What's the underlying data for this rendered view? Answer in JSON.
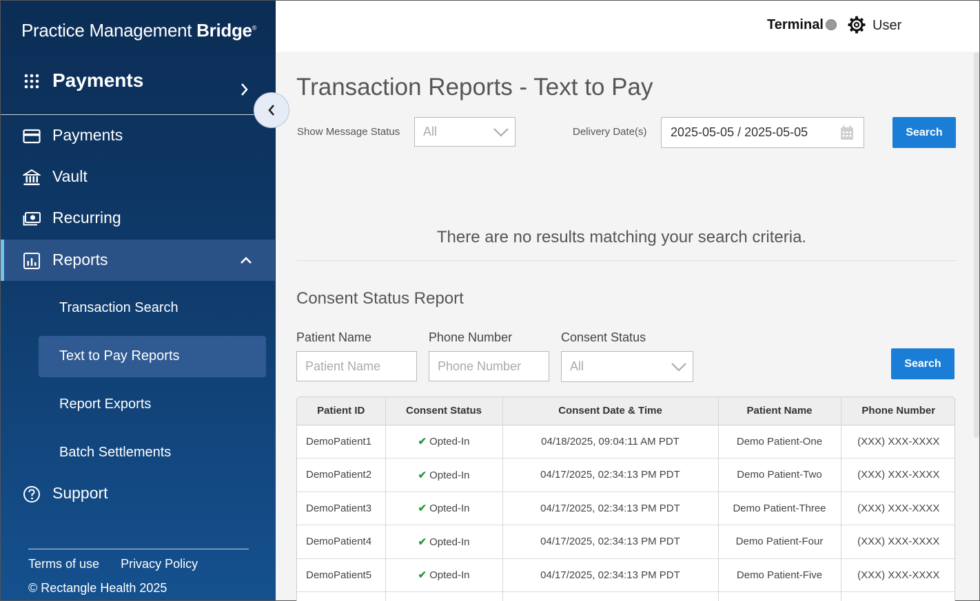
{
  "brand": {
    "logo_text_light": "Practice Management",
    "logo_text_bold": "Bridge",
    "logo_mark": "®"
  },
  "app_switcher": {
    "title": "Payments"
  },
  "nav": {
    "items": [
      {
        "label": "Payments",
        "icon": "credit-card-icon"
      },
      {
        "label": "Vault",
        "icon": "bank-icon"
      },
      {
        "label": "Recurring",
        "icon": "money-icon"
      },
      {
        "label": "Reports",
        "icon": "bar-chart-icon"
      },
      {
        "label": "Support",
        "icon": "question-circle-icon"
      }
    ],
    "report_subitems": [
      {
        "label": "Transaction Search"
      },
      {
        "label": "Text to Pay Reports"
      },
      {
        "label": "Report Exports"
      },
      {
        "label": "Batch Settlements"
      }
    ]
  },
  "footer": {
    "terms": "Terms of use",
    "privacy": "Privacy Policy",
    "copyright": "© Rectangle Health 2025"
  },
  "topbar": {
    "terminal_label": "Terminal",
    "terminal_status_color": "#9a9a9a",
    "user_label": "User"
  },
  "page": {
    "title": "Transaction Reports - Text to Pay",
    "filters": {
      "message_status_label": "Show Message Status",
      "message_status_value": "All",
      "delivery_dates_label": "Delivery Date(s)",
      "delivery_dates_value": "2025-05-05 / 2025-05-05",
      "search_label": "Search"
    },
    "no_results": "There are no results matching your search criteria."
  },
  "consent": {
    "title": "Consent Status Report",
    "patient_name_label": "Patient Name",
    "patient_name_placeholder": "Patient Name",
    "phone_label": "Phone Number",
    "phone_placeholder": "Phone Number",
    "status_label": "Consent Status",
    "status_value": "All",
    "search_label": "Search",
    "columns": [
      "Patient ID",
      "Consent Status",
      "Consent Date & Time",
      "Patient Name",
      "Phone Number"
    ],
    "rows": [
      {
        "id": "DemoPatient1",
        "status": "Opted-In",
        "datetime": "04/18/2025, 09:04:11 AM PDT",
        "name": "Demo Patient-One",
        "phone": "(XXX) XXX-XXXX"
      },
      {
        "id": "DemoPatient2",
        "status": "Opted-In",
        "datetime": "04/17/2025, 02:34:13 PM PDT",
        "name": "Demo Patient-Two",
        "phone": "(XXX) XXX-XXXX"
      },
      {
        "id": "DemoPatient3",
        "status": "Opted-In",
        "datetime": "04/17/2025, 02:34:13 PM PDT",
        "name": "Demo Patient-Three",
        "phone": "(XXX) XXX-XXXX"
      },
      {
        "id": "DemoPatient4",
        "status": "Opted-In",
        "datetime": "04/17/2025, 02:34:13 PM PDT",
        "name": "Demo Patient-Four",
        "phone": "(XXX) XXX-XXXX"
      },
      {
        "id": "DemoPatient5",
        "status": "Opted-In",
        "datetime": "04/17/2025, 02:34:13 PM PDT",
        "name": "Demo Patient-Five",
        "phone": "(XXX) XXX-XXXX"
      }
    ]
  },
  "colors": {
    "sidebar": "#0f3a6a",
    "accent": "#1a7ed6",
    "active_indicator": "#6ec3ee",
    "opted_in": "#2a9a3a"
  }
}
